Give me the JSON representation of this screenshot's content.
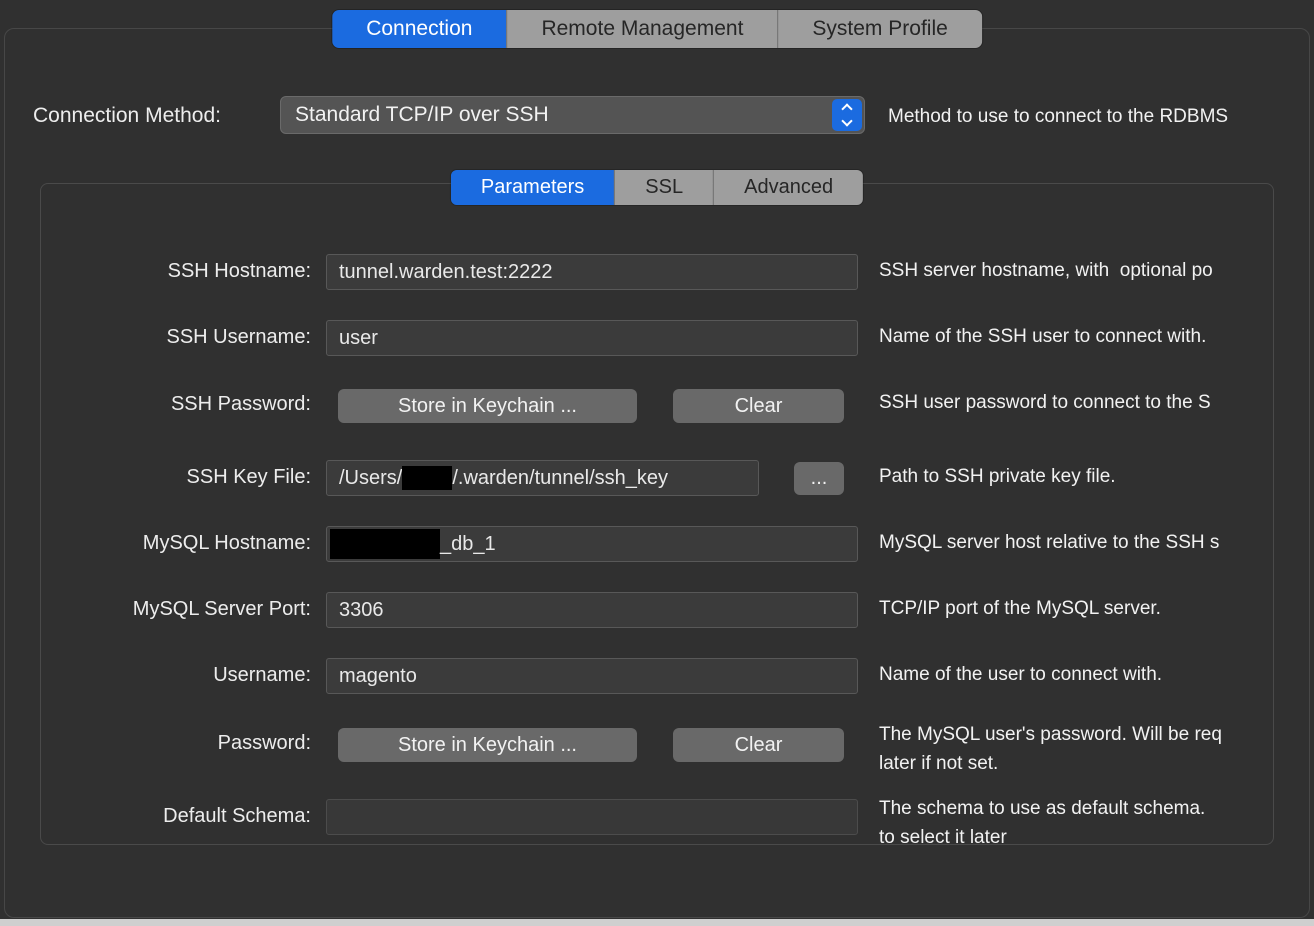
{
  "tabs": {
    "items": [
      {
        "label": "Connection",
        "active": true
      },
      {
        "label": "Remote Management",
        "active": false
      },
      {
        "label": "System Profile",
        "active": false
      }
    ]
  },
  "connection_method": {
    "label": "Connection Method:",
    "value": "Standard TCP/IP over SSH",
    "help": "Method to use to connect to the RDBMS"
  },
  "subtabs": {
    "items": [
      {
        "label": "Parameters",
        "active": true
      },
      {
        "label": "SSL",
        "active": false
      },
      {
        "label": "Advanced",
        "active": false
      }
    ]
  },
  "form": {
    "ssh_hostname": {
      "label": "SSH Hostname:",
      "value": "tunnel.warden.test:2222",
      "help": "SSH server hostname, with  optional po"
    },
    "ssh_username": {
      "label": "SSH Username:",
      "value": "user",
      "help": "Name of the SSH user to connect with."
    },
    "ssh_password": {
      "label": "SSH Password:",
      "store_button": "Store in Keychain ...",
      "clear_button": "Clear",
      "help": "SSH user password to connect to the S"
    },
    "ssh_key_file": {
      "label": "SSH Key File:",
      "value_prefix": "/Users/",
      "value_suffix": "/.warden/tunnel/ssh_key",
      "redacted": true,
      "browse_button": "...",
      "help": "Path to SSH private key file."
    },
    "mysql_hostname": {
      "label": "MySQL Hostname:",
      "value_suffix": "_db_1",
      "redacted": true,
      "help": "MySQL server host relative to the SSH s"
    },
    "mysql_server_port": {
      "label": "MySQL Server Port:",
      "value": "3306",
      "help": "TCP/IP port of the MySQL server."
    },
    "username": {
      "label": "Username:",
      "value": "magento",
      "help": "Name of the user to connect with."
    },
    "password": {
      "label": "Password:",
      "store_button": "Store in Keychain ...",
      "clear_button": "Clear",
      "help": "The MySQL user's password. Will be req\nlater if not set."
    },
    "default_schema": {
      "label": "Default Schema:",
      "value": "",
      "help": "The schema to use as default schema.\nto select it later"
    }
  },
  "colors": {
    "accent_blue": "#1b6be0",
    "background": "#303030",
    "tab_inactive": "#9e9e9e",
    "input_background": "#3b3b3b",
    "button_gray": "#696969"
  }
}
